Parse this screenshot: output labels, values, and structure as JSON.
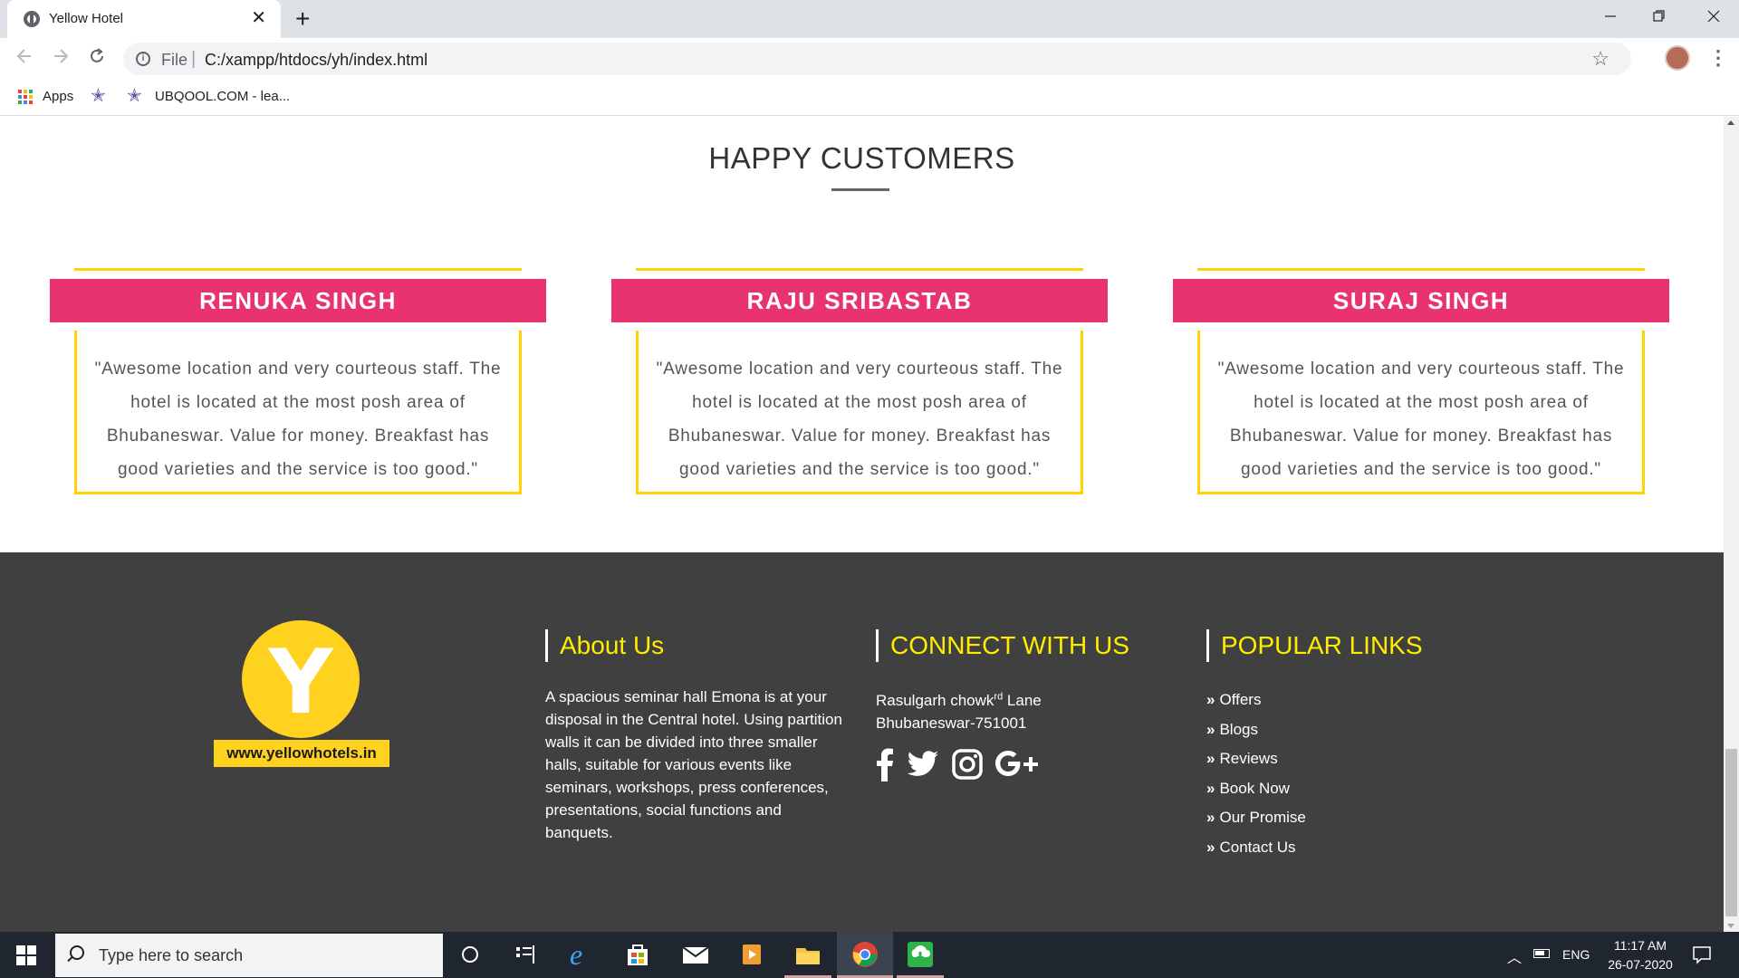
{
  "browser": {
    "tab_title": "Yellow Hotel",
    "tab_close": "✕",
    "new_tab": "+",
    "url_scheme": "File",
    "url": "C:/xampp/htdocs/yh/index.html",
    "bookmarks": [
      {
        "label": "Apps"
      },
      {
        "label": ""
      },
      {
        "label": "UBQOOL.COM - lea..."
      }
    ],
    "icons": {
      "back": "arrow-left-icon",
      "forward": "arrow-right-icon",
      "reload": "reload-icon",
      "star": "star-icon",
      "menu": "more-vert-icon"
    }
  },
  "page": {
    "section_title": "HAPPY CUSTOMERS",
    "testimonials": [
      {
        "name": "RENUKA SINGH",
        "quote": "\"Awesome location and very courteous staff. The hotel is located at the most posh area of Bhubaneswar. Value for money. Breakfast has good varieties and the service is too good.\""
      },
      {
        "name": "RAJU SRIBASTAB",
        "quote": "\"Awesome location and very courteous staff. The hotel is located at the most posh area of Bhubaneswar. Value for money. Breakfast has good varieties and the service is too good.\""
      },
      {
        "name": "SURAJ SINGH",
        "quote": "\"Awesome location and very courteous staff. The hotel is located at the most posh area of Bhubaneswar. Value for money. Breakfast has good varieties and the service is too good.\""
      }
    ],
    "colors": {
      "accent_pink": "#e83370",
      "accent_yellow": "#ffd200",
      "footer_bg": "#404040",
      "footer_heading": "#ffed00"
    }
  },
  "footer": {
    "logo_letter": "Y",
    "logo_url": "www.yellowhotels.in",
    "about": {
      "heading": "About Us",
      "text": "A spacious seminar hall Emona is at your disposal in the Central hotel. Using partition walls it can be divided into three smaller halls, suitable for various events like seminars, workshops, press conferences, presentations, social functions and banquets."
    },
    "connect": {
      "heading": "CONNECT WITH US",
      "address_line1_pre": "Rasulgarh chowk",
      "address_line1_sup": "rd",
      "address_line1_post": " Lane",
      "address_line2": "Bhubaneswar-751001",
      "social_icons": [
        "facebook-icon",
        "twitter-icon",
        "instagram-icon",
        "google-plus-icon"
      ]
    },
    "popular": {
      "heading": "POPULAR LINKS",
      "links": [
        "Offers",
        "Blogs",
        "Reviews",
        "Book Now",
        "Our Promise",
        "Contact Us"
      ]
    }
  },
  "taskbar": {
    "search_placeholder": "Type here to search",
    "language": "ENG",
    "time": "11:17 AM",
    "date": "26-07-2020"
  }
}
